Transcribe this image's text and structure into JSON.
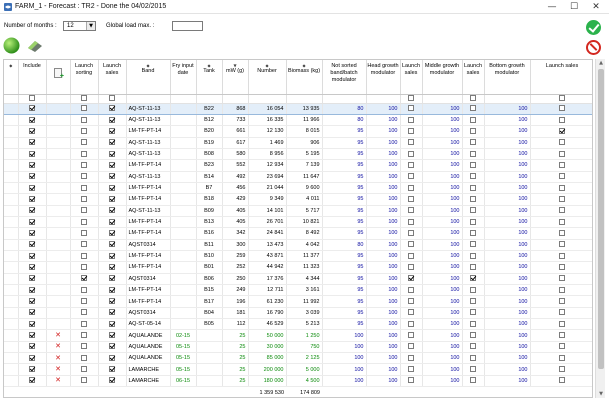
{
  "window": {
    "title": "FARM_1 - Forecast : TR2 - Done the 04/02/2015",
    "minimize": "—",
    "maximize": "☐",
    "close": "✕"
  },
  "controls": {
    "months_label": "Number of months :",
    "months_value": "12",
    "load_label": "Global load max. :",
    "load_value": ""
  },
  "columns": [
    "",
    "Include",
    "",
    "Launch sorting",
    "Launch sales",
    "Band",
    "Fry input date",
    "Tank",
    "mW (g)",
    "Number",
    "Biomass (kg)",
    "Not sorted band/batch modulator",
    "Head growth modulator",
    "Launch sales",
    "Middle growth modulator",
    "Launch sales",
    "Bottom growth modulator",
    "Launch sales"
  ],
  "rows": [
    {
      "inc": true,
      "del": false,
      "sort": false,
      "sales": true,
      "band": "AQ-ST-11-13",
      "date": "",
      "tank": "B22",
      "mw": "868",
      "number": "16 054",
      "biomass": "13 935",
      "m1": "80",
      "m2": "100",
      "s2": false,
      "m3": "100",
      "s3": false,
      "m4": "100",
      "s4": false
    },
    {
      "inc": true,
      "del": false,
      "sort": false,
      "sales": true,
      "band": "AQ-ST-11-13",
      "date": "",
      "tank": "B12",
      "mw": "733",
      "number": "16 335",
      "biomass": "11 966",
      "m1": "80",
      "m2": "100",
      "s2": false,
      "m3": "100",
      "s3": false,
      "m4": "100",
      "s4": false
    },
    {
      "inc": true,
      "del": false,
      "sort": false,
      "sales": true,
      "band": "LM-TF-PT-14",
      "date": "",
      "tank": "B20",
      "mw": "661",
      "number": "12 130",
      "biomass": "8 015",
      "m1": "95",
      "m2": "100",
      "s2": false,
      "m3": "100",
      "s3": false,
      "m4": "100",
      "s4": true
    },
    {
      "inc": true,
      "del": false,
      "sort": false,
      "sales": true,
      "band": "AQ-ST-11-13",
      "date": "",
      "tank": "B19",
      "mw": "617",
      "number": "1 469",
      "biomass": "906",
      "m1": "95",
      "m2": "100",
      "s2": false,
      "m3": "100",
      "s3": false,
      "m4": "100",
      "s4": false
    },
    {
      "inc": true,
      "del": false,
      "sort": false,
      "sales": true,
      "band": "AQ-ST-11-13",
      "date": "",
      "tank": "B08",
      "mw": "580",
      "number": "8 956",
      "biomass": "5 195",
      "m1": "95",
      "m2": "100",
      "s2": false,
      "m3": "100",
      "s3": false,
      "m4": "100",
      "s4": false
    },
    {
      "inc": true,
      "del": false,
      "sort": false,
      "sales": true,
      "band": "LM-TF-PT-14",
      "date": "",
      "tank": "B23",
      "mw": "552",
      "number": "12 934",
      "biomass": "7 139",
      "m1": "95",
      "m2": "100",
      "s2": false,
      "m3": "100",
      "s3": false,
      "m4": "100",
      "s4": false
    },
    {
      "inc": true,
      "del": false,
      "sort": false,
      "sales": true,
      "band": "AQ-ST-11-13",
      "date": "",
      "tank": "B14",
      "mw": "492",
      "number": "23 694",
      "biomass": "11 647",
      "m1": "95",
      "m2": "100",
      "s2": false,
      "m3": "100",
      "s3": false,
      "m4": "100",
      "s4": false
    },
    {
      "inc": true,
      "del": false,
      "sort": false,
      "sales": true,
      "band": "LM-TF-PT-14",
      "date": "",
      "tank": "B7",
      "mw": "456",
      "number": "21 044",
      "biomass": "9 600",
      "m1": "95",
      "m2": "100",
      "s2": false,
      "m3": "100",
      "s3": false,
      "m4": "100",
      "s4": false
    },
    {
      "inc": true,
      "del": false,
      "sort": false,
      "sales": true,
      "band": "LM-TF-PT-14",
      "date": "",
      "tank": "B18",
      "mw": "429",
      "number": "9 349",
      "biomass": "4 011",
      "m1": "95",
      "m2": "100",
      "s2": false,
      "m3": "100",
      "s3": false,
      "m4": "100",
      "s4": false
    },
    {
      "inc": true,
      "del": false,
      "sort": false,
      "sales": true,
      "band": "AQ-ST-11-13",
      "date": "",
      "tank": "B09",
      "mw": "405",
      "number": "14 101",
      "biomass": "5 717",
      "m1": "95",
      "m2": "100",
      "s2": false,
      "m3": "100",
      "s3": false,
      "m4": "100",
      "s4": false
    },
    {
      "inc": true,
      "del": false,
      "sort": false,
      "sales": true,
      "band": "LM-TF-PT-14",
      "date": "",
      "tank": "B13",
      "mw": "405",
      "number": "26 701",
      "biomass": "10 821",
      "m1": "95",
      "m2": "100",
      "s2": false,
      "m3": "100",
      "s3": false,
      "m4": "100",
      "s4": false
    },
    {
      "inc": true,
      "del": false,
      "sort": false,
      "sales": true,
      "band": "LM-TF-PT-14",
      "date": "",
      "tank": "B16",
      "mw": "342",
      "number": "24 841",
      "biomass": "8 492",
      "m1": "95",
      "m2": "100",
      "s2": false,
      "m3": "100",
      "s3": false,
      "m4": "100",
      "s4": false
    },
    {
      "inc": true,
      "del": false,
      "sort": false,
      "sales": true,
      "band": "AQST0314",
      "date": "",
      "tank": "B11",
      "mw": "300",
      "number": "13 473",
      "biomass": "4 042",
      "m1": "80",
      "m2": "100",
      "s2": false,
      "m3": "100",
      "s3": false,
      "m4": "100",
      "s4": false
    },
    {
      "inc": true,
      "del": false,
      "sort": false,
      "sales": true,
      "band": "LM-TF-PT-14",
      "date": "",
      "tank": "B10",
      "mw": "259",
      "number": "43 871",
      "biomass": "11 377",
      "m1": "95",
      "m2": "100",
      "s2": false,
      "m3": "100",
      "s3": false,
      "m4": "100",
      "s4": false
    },
    {
      "inc": true,
      "del": false,
      "sort": false,
      "sales": true,
      "band": "LM-TF-PT-14",
      "date": "",
      "tank": "B01",
      "mw": "252",
      "number": "44 942",
      "biomass": "11 323",
      "m1": "95",
      "m2": "100",
      "s2": false,
      "m3": "100",
      "s3": false,
      "m4": "100",
      "s4": false
    },
    {
      "inc": true,
      "del": false,
      "sort": true,
      "sales": true,
      "band": "AQST0314",
      "date": "",
      "tank": "B06",
      "mw": "250",
      "number": "17 376",
      "biomass": "4 344",
      "m1": "95",
      "m2": "100",
      "s2": true,
      "m3": "100",
      "s3": true,
      "m4": "100",
      "s4": false
    },
    {
      "inc": true,
      "del": false,
      "sort": false,
      "sales": true,
      "band": "LM-TF-PT-14",
      "date": "",
      "tank": "B15",
      "mw": "249",
      "number": "12 711",
      "biomass": "3 161",
      "m1": "95",
      "m2": "100",
      "s2": false,
      "m3": "100",
      "s3": false,
      "m4": "100",
      "s4": false
    },
    {
      "inc": true,
      "del": false,
      "sort": false,
      "sales": true,
      "band": "LM-TF-PT-14",
      "date": "",
      "tank": "B17",
      "mw": "196",
      "number": "61 230",
      "biomass": "11 992",
      "m1": "95",
      "m2": "100",
      "s2": false,
      "m3": "100",
      "s3": false,
      "m4": "100",
      "s4": false
    },
    {
      "inc": true,
      "del": false,
      "sort": false,
      "sales": true,
      "band": "AQST0314",
      "date": "",
      "tank": "B04",
      "mw": "181",
      "number": "16 790",
      "biomass": "3 039",
      "m1": "95",
      "m2": "100",
      "s2": false,
      "m3": "100",
      "s3": false,
      "m4": "100",
      "s4": false
    },
    {
      "inc": true,
      "del": false,
      "sort": false,
      "sales": true,
      "band": "AQ-ST-05-14",
      "date": "",
      "tank": "B05",
      "mw": "112",
      "number": "46 529",
      "biomass": "5 213",
      "m1": "95",
      "m2": "100",
      "s2": false,
      "m3": "100",
      "s3": false,
      "m4": "100",
      "s4": false
    },
    {
      "inc": true,
      "del": true,
      "sort": false,
      "sales": true,
      "band": "AQUALANDE",
      "date": "02-15",
      "tank": "",
      "mw": "25",
      "number": "50 000",
      "biomass": "1 250",
      "m1": "100",
      "m2": "100",
      "s2": false,
      "m3": "100",
      "s3": false,
      "m4": "100",
      "s4": false
    },
    {
      "inc": true,
      "del": true,
      "sort": false,
      "sales": true,
      "band": "AQUALANDE",
      "date": "05-15",
      "tank": "",
      "mw": "25",
      "number": "30 000",
      "biomass": "750",
      "m1": "100",
      "m2": "100",
      "s2": false,
      "m3": "100",
      "s3": false,
      "m4": "100",
      "s4": false
    },
    {
      "inc": true,
      "del": true,
      "sort": false,
      "sales": true,
      "band": "AQUALANDE",
      "date": "05-15",
      "tank": "",
      "mw": "25",
      "number": "85 000",
      "biomass": "2 125",
      "m1": "100",
      "m2": "100",
      "s2": false,
      "m3": "100",
      "s3": false,
      "m4": "100",
      "s4": false
    },
    {
      "inc": true,
      "del": true,
      "sort": false,
      "sales": true,
      "band": "LAMARCHE",
      "date": "05-15",
      "tank": "",
      "mw": "25",
      "number": "200 000",
      "biomass": "5 000",
      "m1": "100",
      "m2": "100",
      "s2": false,
      "m3": "100",
      "s3": false,
      "m4": "100",
      "s4": false
    },
    {
      "inc": true,
      "del": true,
      "sort": false,
      "sales": true,
      "band": "LAMARCHE",
      "date": "06-15",
      "tank": "",
      "mw": "25",
      "number": "180 000",
      "biomass": "4 500",
      "m1": "100",
      "m2": "100",
      "s2": false,
      "m3": "100",
      "s3": false,
      "m4": "100",
      "s4": false
    }
  ],
  "totals": {
    "number": "1 359 530",
    "biomass": "174 809"
  },
  "icons": {
    "app": "fish-farm-icon",
    "tool1": "green-sphere-icon",
    "tool2": "eraser-icon",
    "ok": "check-icon",
    "cancel": "no-entry-icon",
    "add": "add-row-icon",
    "delete": "delete-x-icon"
  },
  "colors": {
    "green_text": "#0a8a0a",
    "blue_text": "#0b0ba0",
    "delete": "#d01818",
    "ok": "#2bb24c",
    "cancel": "#d3271f"
  }
}
